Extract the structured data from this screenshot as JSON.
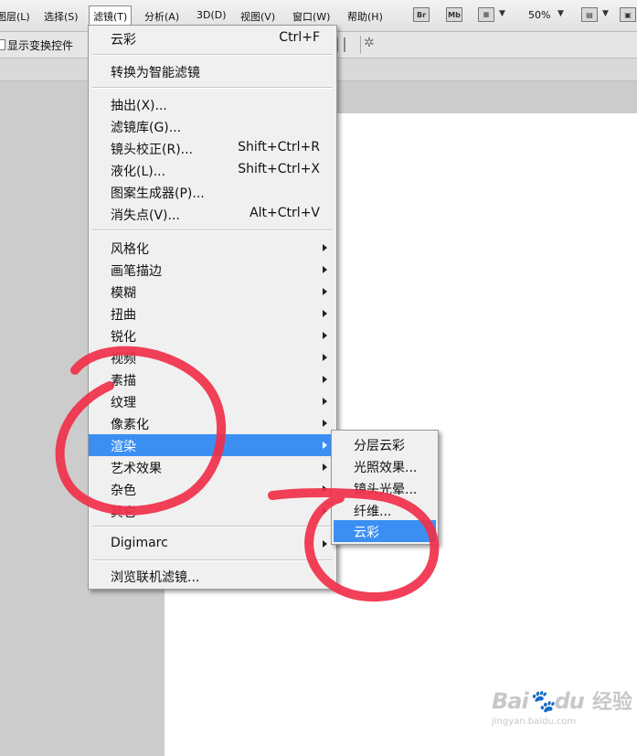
{
  "menubar": {
    "items": [
      {
        "label": "图层(L)"
      },
      {
        "label": "选择(S)"
      },
      {
        "label": "滤镜(T)"
      },
      {
        "label": "分析(A)"
      },
      {
        "label": "3D(D)"
      },
      {
        "label": "视图(V)"
      },
      {
        "label": "窗口(W)"
      },
      {
        "label": "帮助(H)"
      }
    ],
    "br_label": "Br",
    "mb_label": "Mb",
    "zoom": "50%"
  },
  "options": {
    "show_transform": "显示变换控件"
  },
  "filter_menu": {
    "items": [
      {
        "label": "云彩",
        "shortcut": "Ctrl+F"
      },
      {
        "label": "转换为智能滤镜",
        "shortcut": ""
      },
      {
        "label": "抽出(X)...",
        "shortcut": ""
      },
      {
        "label": "滤镜库(G)...",
        "shortcut": ""
      },
      {
        "label": "镜头校正(R)...",
        "shortcut": "Shift+Ctrl+R"
      },
      {
        "label": "液化(L)...",
        "shortcut": "Shift+Ctrl+X"
      },
      {
        "label": "图案生成器(P)...",
        "shortcut": ""
      },
      {
        "label": "消失点(V)...",
        "shortcut": "Alt+Ctrl+V"
      },
      {
        "label": "风格化",
        "shortcut": ""
      },
      {
        "label": "画笔描边",
        "shortcut": ""
      },
      {
        "label": "模糊",
        "shortcut": ""
      },
      {
        "label": "扭曲",
        "shortcut": ""
      },
      {
        "label": "锐化",
        "shortcut": ""
      },
      {
        "label": "视频",
        "shortcut": ""
      },
      {
        "label": "素描",
        "shortcut": ""
      },
      {
        "label": "纹理",
        "shortcut": ""
      },
      {
        "label": "像素化",
        "shortcut": ""
      },
      {
        "label": "渲染",
        "shortcut": ""
      },
      {
        "label": "艺术效果",
        "shortcut": ""
      },
      {
        "label": "杂色",
        "shortcut": ""
      },
      {
        "label": "其它",
        "shortcut": ""
      },
      {
        "label": "Digimarc",
        "shortcut": ""
      },
      {
        "label": "浏览联机滤镜...",
        "shortcut": ""
      }
    ]
  },
  "render_submenu": {
    "items": [
      {
        "label": "分层云彩"
      },
      {
        "label": "光照效果..."
      },
      {
        "label": "镜头光晕..."
      },
      {
        "label": "纤维..."
      },
      {
        "label": "云彩"
      }
    ]
  },
  "watermark": {
    "brand": "Bai",
    "brand_tail": "du",
    "jingyan": "经验",
    "url": "jingyan.baidu.com"
  },
  "colors": {
    "highlight": "#3b8ff3",
    "annotation": "#f0304a"
  }
}
